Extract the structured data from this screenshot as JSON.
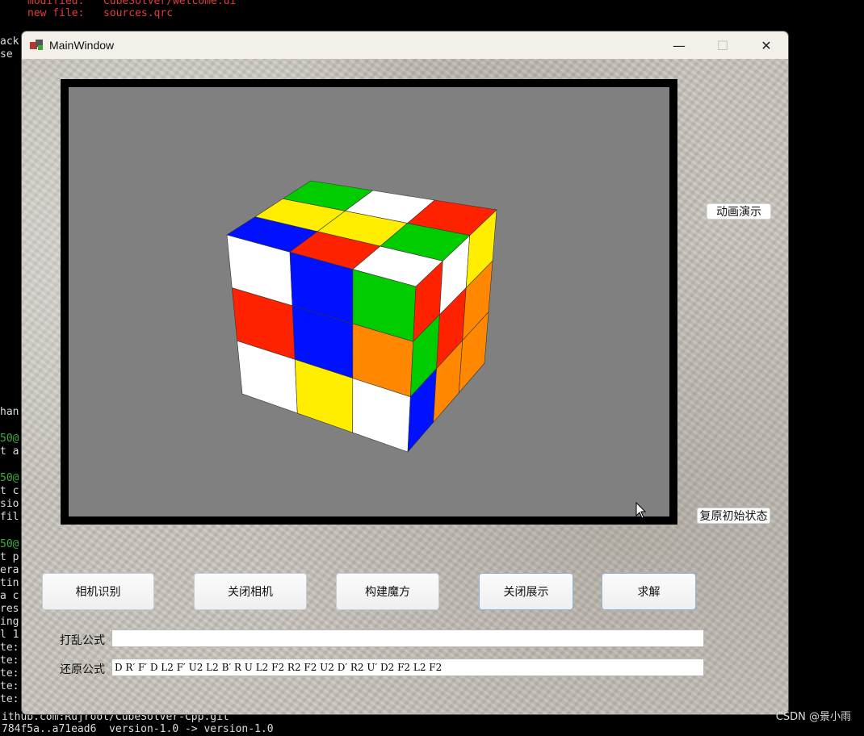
{
  "terminal": {
    "modified_label": "modified:",
    "modified_file": "CubeSolver/welcome.ui",
    "newfile_label": "new file:",
    "newfile_file": "sources.qrc",
    "left_fragments": [
      "ack",
      "se",
      "han",
      "50@",
      "t a",
      "50@",
      "t c",
      "sio",
      "fil",
      "50@",
      "t p",
      "era",
      "tin",
      "a c",
      "res",
      "ing",
      "l 1",
      "te:",
      "te:",
      "te:",
      "te:",
      "te:"
    ],
    "bottom_line1": "ithub.com:Rujroot/CubeSolver-Cpp.git",
    "bottom_line2": "784f5a..a71ead6  version-1.0 -> version-1.0"
  },
  "window": {
    "title": "MainWindow",
    "minimize_glyph": "—",
    "maximize_glyph": "☐",
    "close_glyph": "✕"
  },
  "buttons": {
    "animate": "动画演示",
    "reset": "复原初始状态",
    "camera_detect": "相机识别",
    "close_camera": "关闭相机",
    "build_cube": "构建魔方",
    "close_display": "关闭展示",
    "solve": "求解"
  },
  "fields": {
    "scramble_label": "打乱公式",
    "scramble_value": "",
    "restore_label": "还原公式",
    "restore_value": "D R′ F′ D L2 F′ U2 L2 B′ R U L2 F2 R2 F2 U2 D′ R2 U′ D2 F2 L2 F2"
  },
  "watermark": "CSDN @景小雨",
  "cube": {
    "colors": {
      "white": "#ffffff",
      "yellow": "#ffee00",
      "red": "#ff2200",
      "green": "#00cc00",
      "blue": "#0011ff",
      "orange": "#ff8800"
    },
    "top_face": [
      [
        "green",
        "white",
        "red"
      ],
      [
        "yellow",
        "yellow",
        "green"
      ],
      [
        "blue",
        "red",
        "white"
      ]
    ],
    "front_face": [
      [
        "white",
        "blue",
        "green"
      ],
      [
        "red",
        "blue",
        "orange"
      ],
      [
        "white",
        "yellow",
        "white"
      ]
    ],
    "right_face": [
      [
        "red",
        "white",
        "yellow"
      ],
      [
        "green",
        "red",
        "orange"
      ],
      [
        "blue",
        "orange",
        "orange"
      ]
    ]
  }
}
